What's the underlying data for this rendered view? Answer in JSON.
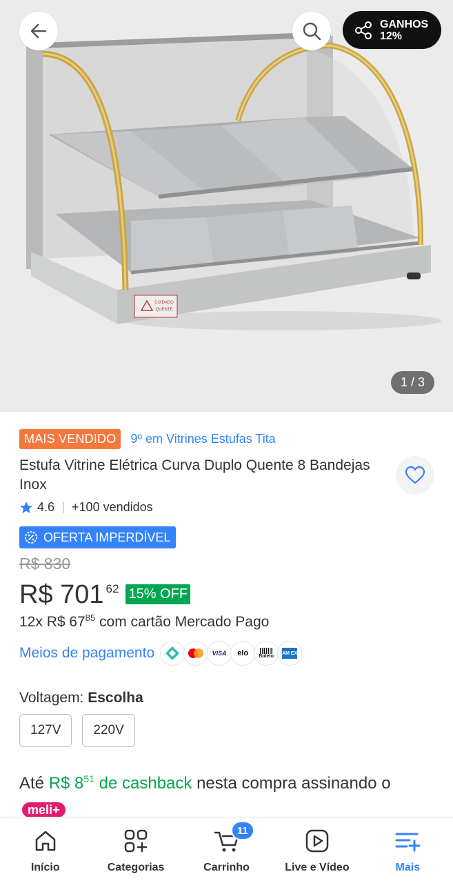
{
  "gallery": {
    "earnings_label": "GANHOS",
    "earnings_value": "12%",
    "page_indicator": "1 / 3",
    "product_label_warning": "CUIDADO QUENTE"
  },
  "product": {
    "badge": "MAIS VENDIDO",
    "ranking": "9º em Vitrines Estufas Tita",
    "title": "Estufa Vitrine Elétrica Curva Duplo Quente 8 Bandejas Inox",
    "rating": "4.6",
    "sold": "+100 vendidos",
    "offer_badge": "OFERTA IMPERDÍVEL",
    "old_price": "R$ 830",
    "price": "R$ 701",
    "price_cents": "62",
    "discount": "15% OFF",
    "installment_prefix": "12x R$ 67",
    "installment_cents": "85",
    "installment_suffix": " com cartão Mercado Pago",
    "payment_link": "Meios de pagamento",
    "payment_icons": [
      "pix-icon",
      "mastercard-icon",
      "visa-icon",
      "elo-icon",
      "boleto-icon",
      "amex-icon"
    ],
    "payment_icon_labels": {
      "visa": "VISA",
      "elo": "elo",
      "boleto": "Boleto",
      "amex": "AM EX"
    }
  },
  "voltage": {
    "label": "Voltagem: ",
    "selection": "Escolha",
    "options": [
      "127V",
      "220V"
    ]
  },
  "cashback": {
    "prefix": "Até ",
    "amount": "R$ 8",
    "amount_cents": "51",
    "amount_suffix": " de cashback",
    "middle": " nesta compra assinando o ",
    "brand": "meli+"
  },
  "nav": {
    "items": [
      "Início",
      "Categorias",
      "Carrinho",
      "Live e Vídeo",
      "Mais"
    ],
    "cart_count": "11"
  },
  "colors": {
    "accent_blue": "#3483fa",
    "green": "#00a650",
    "orange": "#f4773b",
    "meli_pink": "#e31b6d"
  }
}
